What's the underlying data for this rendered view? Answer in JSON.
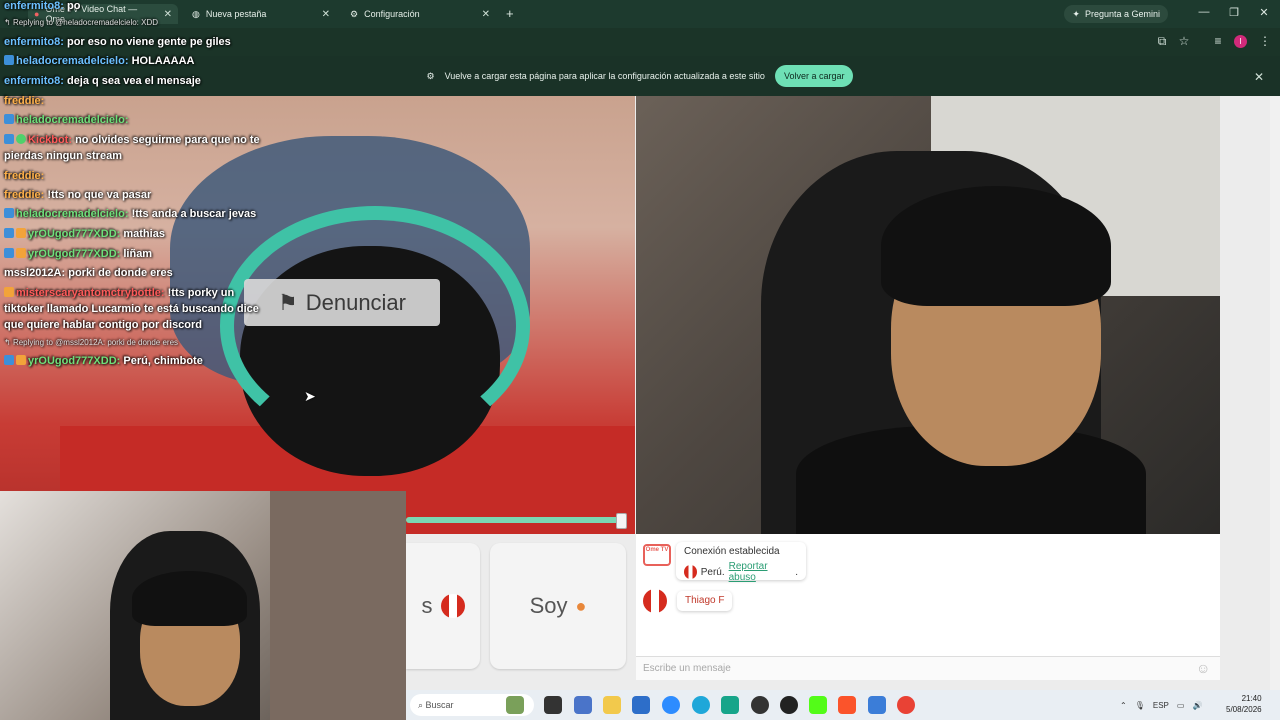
{
  "browser": {
    "tabs": [
      {
        "label": "Ome TV Video Chat — Ome",
        "icon": "record-icon"
      },
      {
        "label": "Nueva pestaña",
        "icon": "globe-icon"
      },
      {
        "label": "Configuración",
        "icon": "gear-icon"
      }
    ],
    "gemini_label": "Pregunta a Gemini",
    "avatar_letter": "I",
    "info_message": "Vuelve a cargar esta página para aplicar la configuración actualizada a este sitio",
    "reload_label": "Volver a cargar"
  },
  "stream_chat": [
    {
      "user": "enfermito8:",
      "text": "po"
    },
    {
      "reply": "Replying to @heladocremadelcielo: XDD"
    },
    {
      "user": "enfermito8:",
      "text": "por eso no viene gente pe giles"
    },
    {
      "user": "heladocremadelcielo:",
      "text": "HOLAAAAA"
    },
    {
      "user": "enfermito8:",
      "text": "deja q sea vea el mensaje"
    },
    {
      "user": "freddie:",
      "text": ""
    },
    {
      "user": "heladocremadelcielo:",
      "text": ""
    },
    {
      "user": "Kickbot:",
      "text": "no olvides seguirme para que no te"
    },
    {
      "cont": "pierdas ningun stream"
    },
    {
      "user": "freddie:",
      "text": ""
    },
    {
      "user": "freddie:",
      "text": "!tts no que va pasar"
    },
    {
      "user": "heladocremadelcielo:",
      "text": "!tts anda a buscar jevas"
    },
    {
      "user": "yrOUgod777XDD:",
      "text": "mathias"
    },
    {
      "user": "yrOUgod777XDD:",
      "text": "liñam"
    },
    {
      "user": "mssl2012A:",
      "text": "porki de donde eres"
    },
    {
      "user": "misterscaryantomctrybottle:",
      "text": "!tts porky un"
    },
    {
      "cont": "tiktoker llamado Lucarmio te está buscando dice"
    },
    {
      "cont": "que quiere hablar contigo por discord"
    },
    {
      "reply": "Replying to @mssl2012A: porki de donde eres"
    },
    {
      "user": "yrOUgod777XDD:",
      "text": "Perú, chimbote"
    }
  ],
  "report_button": "Denunciar",
  "cards": {
    "left_text": "s",
    "right_text": "Soy"
  },
  "chat": {
    "logo_text": "Ome TV",
    "connected": "Conexión establecida",
    "country": "Perú.",
    "report_link": "Reportar abuso",
    "partner_name": "Thiago F",
    "input_placeholder": "Escribe un mensaje"
  },
  "taskbar": {
    "search_placeholder": "Buscar",
    "lang": "ESP",
    "time": "21:40",
    "date": "5/08/2026"
  },
  "colors": {
    "accent": "#6ee0b5",
    "chrome": "#1d3a2e",
    "flag_red": "#d52b1e"
  }
}
